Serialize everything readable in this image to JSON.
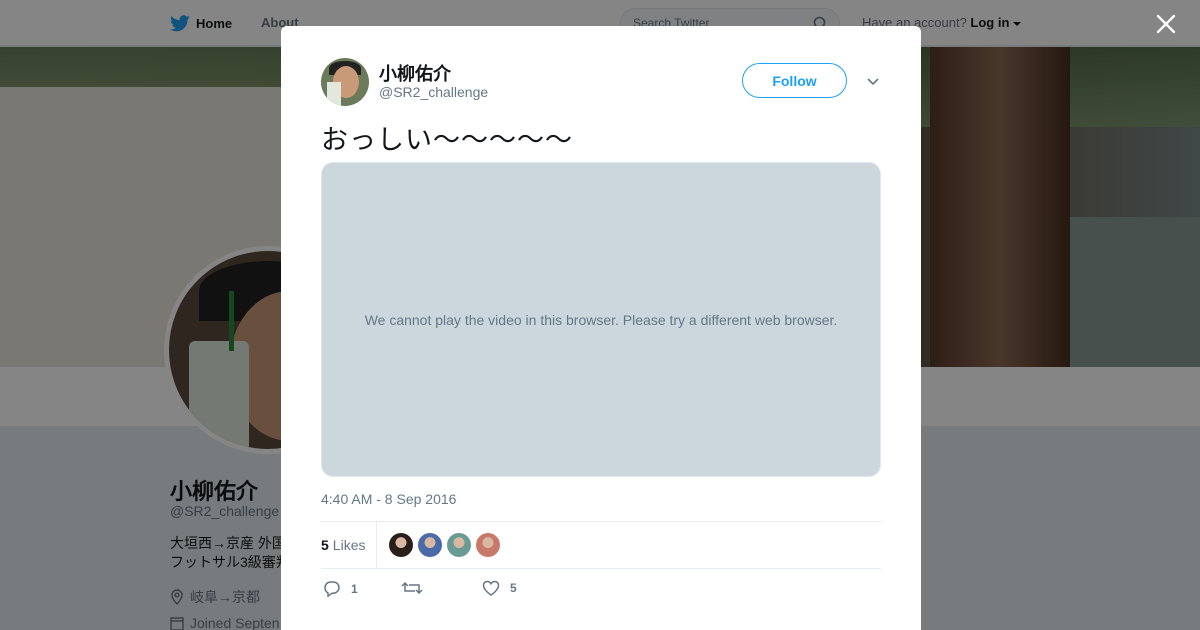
{
  "topbar": {
    "home_label": "Home",
    "about_label": "About",
    "search_placeholder": "Search Twitter",
    "account_prompt": "Have an account?",
    "login_label": "Log in"
  },
  "profile": {
    "name": "小柳佑介",
    "handle": "@SR2_challenge",
    "bio_line1": "大垣西→京産 外国",
    "bio_line2": "フットサル3級審判",
    "location": "岐阜→京都",
    "joined": "Joined Septen"
  },
  "tweet": {
    "name": "小柳佑介",
    "handle": "@SR2_challenge",
    "follow_label": "Follow",
    "text": "おっしい～～～～～",
    "media_message": "We cannot play the video in this browser. Please try a different web browser.",
    "timestamp": "4:40 AM - 8 Sep 2016",
    "likes_count": "5",
    "likes_label": "Likes",
    "likers": [
      "#2a1e1a",
      "#4a6aa8",
      "#6a9a94",
      "#c87a6a"
    ],
    "reply_count": "1",
    "retweet_count": "",
    "like_count": "5"
  },
  "colors": {
    "accent": "#1da1f2",
    "overlay": "rgba(0,0,0,0.48)",
    "media_bg": "#ccd6dd"
  },
  "icons": [
    "twitter-bird-icon",
    "search-icon",
    "dropdown-caret-icon",
    "close-icon",
    "chevron-down-icon",
    "reply-icon",
    "retweet-icon",
    "heart-icon",
    "location-icon",
    "calendar-icon"
  ]
}
